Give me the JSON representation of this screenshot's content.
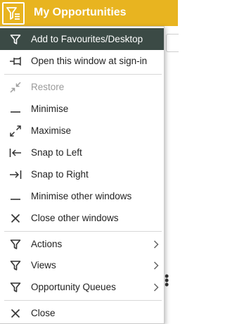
{
  "window": {
    "title": "My Opportunities",
    "accent_color": "#e8b420",
    "title_icon": "filter-menu-icon"
  },
  "menu": {
    "items": [
      {
        "label": "Add to Favourites/Desktop",
        "icon": "filter-icon",
        "state": "highlighted"
      },
      {
        "label": "Open this window at sign-in",
        "icon": "pin-icon"
      },
      {
        "label": "Restore",
        "icon": "restore-icon",
        "state": "disabled"
      },
      {
        "label": "Minimise",
        "icon": "minimise-icon"
      },
      {
        "label": "Maximise",
        "icon": "maximise-icon"
      },
      {
        "label": "Snap to Left",
        "icon": "snap-left-icon"
      },
      {
        "label": "Snap to Right",
        "icon": "snap-right-icon"
      },
      {
        "label": "Minimise other windows",
        "icon": "minimise-icon"
      },
      {
        "label": "Close other windows",
        "icon": "close-icon"
      },
      {
        "label": "Actions",
        "icon": "filter-icon",
        "submenu": true
      },
      {
        "label": "Views",
        "icon": "filter-icon",
        "submenu": true
      },
      {
        "label": "Opportunity Queues",
        "icon": "filter-icon",
        "submenu": true
      },
      {
        "label": "Close",
        "icon": "close-icon"
      }
    ]
  },
  "colors": {
    "highlight_bg": "#3b4a45",
    "disabled_text": "#9a9a9a"
  }
}
